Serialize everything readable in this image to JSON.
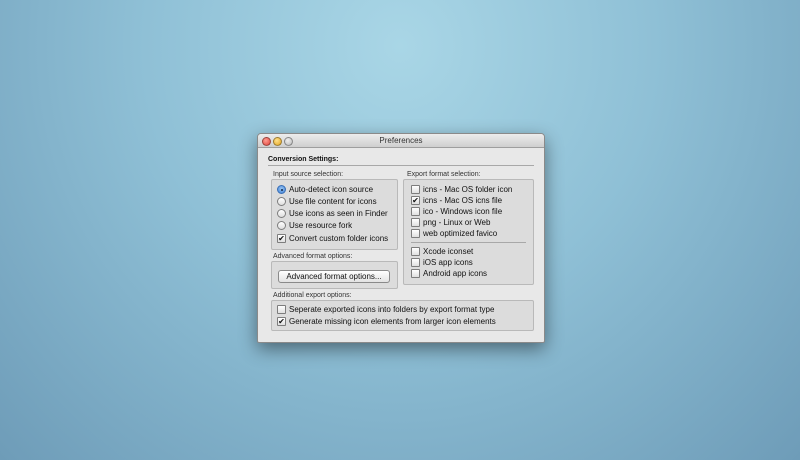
{
  "window": {
    "title": "Preferences"
  },
  "conversion": {
    "heading": "Conversion Settings:"
  },
  "input_source": {
    "label": "Input source selection:",
    "options": [
      {
        "label": "Auto-detect icon source",
        "selected": true
      },
      {
        "label": "Use file content for icons",
        "selected": false
      },
      {
        "label": "Use icons as seen in Finder",
        "selected": false
      },
      {
        "label": "Use resource fork",
        "selected": false
      }
    ],
    "convert_folder": {
      "label": "Convert custom folder icons",
      "checked": true
    }
  },
  "export_format": {
    "label": "Export format selection:",
    "formats": [
      {
        "label": "icns - Mac OS folder icon",
        "checked": false
      },
      {
        "label": "icns - Mac OS icns file",
        "checked": true
      },
      {
        "label": "ico  - Windows icon file",
        "checked": false
      },
      {
        "label": "png - Linux or Web",
        "checked": false
      },
      {
        "label": "web optimized favico",
        "checked": false
      }
    ],
    "targets": [
      {
        "label": "Xcode iconset",
        "checked": false
      },
      {
        "label": "iOS app icons",
        "checked": false
      },
      {
        "label": "Android app icons",
        "checked": false
      }
    ]
  },
  "advanced": {
    "label": "Advanced format options:",
    "button_label": "Advanced format options..."
  },
  "additional": {
    "label": "Additional export options:",
    "options": [
      {
        "label": "Seperate exported icons into folders by export format type",
        "checked": false
      },
      {
        "label": "Generate missing icon elements from larger icon elements",
        "checked": true
      }
    ]
  },
  "check_mark": "✔"
}
